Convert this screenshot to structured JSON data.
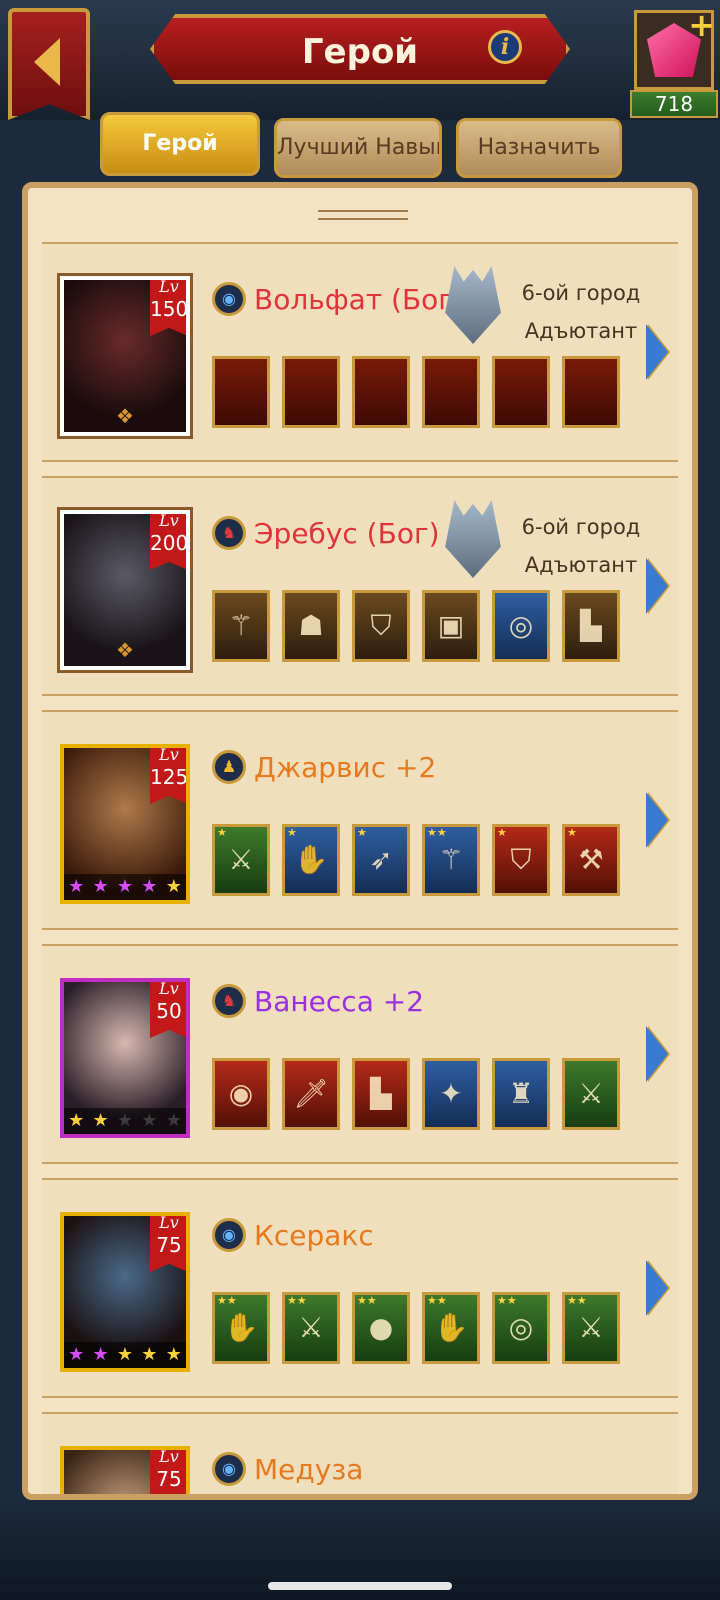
{
  "header": {
    "title": "Герой",
    "gems": "718"
  },
  "tabs": [
    {
      "label": "Герой",
      "active": true
    },
    {
      "label": "Лучший Навык",
      "active": false
    },
    {
      "label": "Назначить",
      "active": false
    }
  ],
  "heroes": [
    {
      "name": "Вольфат (Бог)",
      "level": "150",
      "lv_label": "Lv",
      "name_color": "red",
      "class_icon": "water-class-icon",
      "city": "6-ой город",
      "role": "Адъютант",
      "equipment": [
        "empty",
        "empty",
        "empty",
        "empty",
        "empty",
        "empty"
      ]
    },
    {
      "name": "Эребус (Бог)",
      "level": "200",
      "lv_label": "Lv",
      "name_color": "red",
      "class_icon": "horse-class-icon",
      "city": "6-ой город",
      "role": "Адъютант",
      "equipment": [
        "staff",
        "helmet",
        "armor",
        "bracer",
        "ring",
        "boots"
      ]
    },
    {
      "name": "Джарвис +2",
      "level": "125",
      "lv_label": "Lv",
      "name_color": "orange",
      "class_icon": "archer-class-icon",
      "stars": [
        "purple",
        "purple",
        "purple",
        "purple",
        "gold"
      ],
      "equipment": [
        "sword",
        "gauntlet",
        "bow",
        "scepter",
        "chest",
        "axe"
      ]
    },
    {
      "name": "Ванесса +2",
      "level": "50",
      "lv_label": "Lv",
      "name_color": "purple",
      "class_icon": "horse-class-icon",
      "stars": [
        "gold",
        "gold",
        "empty",
        "empty",
        "empty"
      ],
      "equipment": [
        "necklace",
        "dagger",
        "boots",
        "emblem",
        "lantern",
        "sword"
      ]
    },
    {
      "name": "Ксеракс",
      "level": "75",
      "lv_label": "Lv",
      "name_color": "orange",
      "class_icon": "water-class-icon",
      "stars": [
        "purple",
        "purple",
        "gold",
        "gold",
        "gold"
      ],
      "equipment": [
        "gauntlet",
        "sword",
        "orb",
        "gauntlet",
        "amulet",
        "sword"
      ]
    },
    {
      "name": "Медуза",
      "level": "75",
      "lv_label": "Lv",
      "name_color": "orange",
      "class_icon": "water-class-icon"
    }
  ],
  "colors": {
    "name_red": "#e0333a",
    "name_orange": "#e67a1f",
    "name_purple": "#9b2fe0",
    "panel_bg": "#f3e3c4",
    "gold_frame": "#c99a3c"
  }
}
